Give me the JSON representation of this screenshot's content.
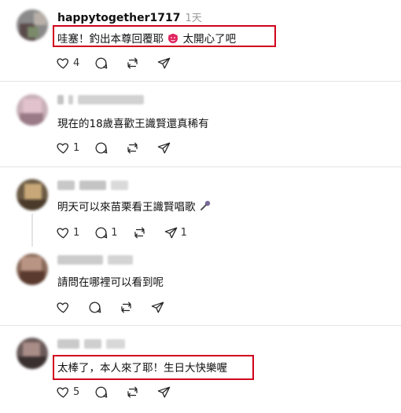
{
  "comments": [
    {
      "username": "happytogether1717",
      "time": "1天",
      "text_before": "哇塞！釣出本尊回覆耶",
      "emoji": "smiling-devil-emoji",
      "text_after": "太開心了吧",
      "likes": "4",
      "replies": "",
      "reposts": "",
      "shares": ""
    },
    {
      "username": "",
      "time": "",
      "text": "現在的18歲喜歡王識賢還真稀有",
      "likes": "1",
      "replies": "",
      "reposts": "",
      "shares": ""
    },
    {
      "username": "",
      "time": "",
      "text": "明天可以來苗栗看王識賢唱歌",
      "emoji": "microphone-emoji",
      "likes": "1",
      "replies": "1",
      "reposts": "",
      "shares": "1"
    },
    {
      "username": "",
      "time": "",
      "text": "請問在哪裡可以看到呢",
      "likes": "",
      "replies": "",
      "reposts": "",
      "shares": ""
    },
    {
      "username": "",
      "time": "",
      "text": "太棒了，本人來了耶！生日大快樂喔",
      "likes": "5",
      "replies": "",
      "reposts": "",
      "shares": ""
    }
  ],
  "colors": {
    "highlight": "#d0021b",
    "divider": "#e4e4e4"
  }
}
